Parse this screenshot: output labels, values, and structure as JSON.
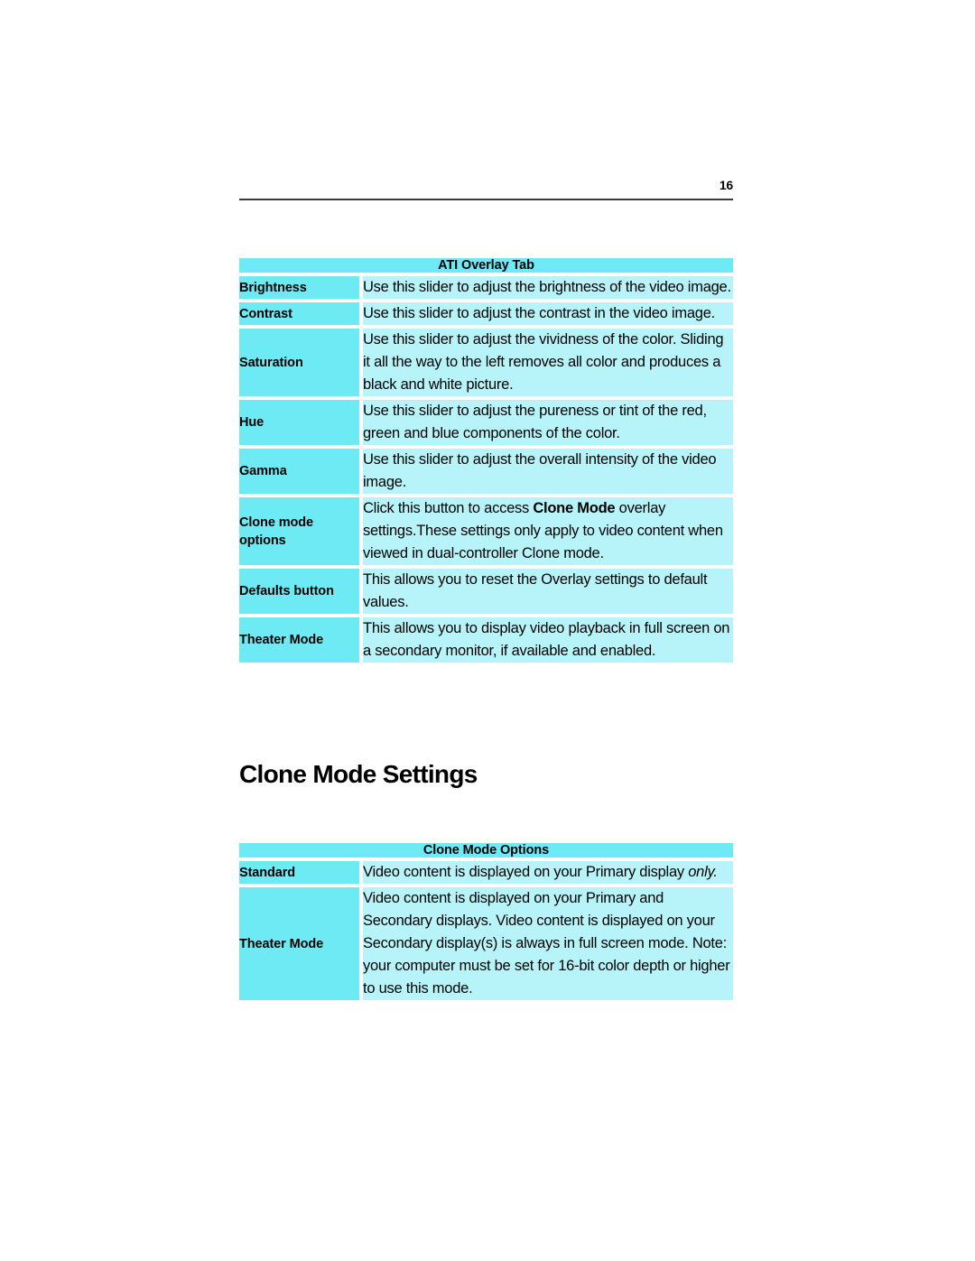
{
  "page": {
    "number": "16"
  },
  "overlay_table": {
    "header": "ATI Overlay Tab",
    "rows": [
      {
        "label": "Brightness",
        "description": "Use this slider to adjust the brightness of the video image."
      },
      {
        "label": "Contrast",
        "description": "Use this slider to adjust the contrast in the video image."
      },
      {
        "label": "Saturation",
        "description": "Use this slider to adjust the vividness of the color. Sliding it all the way to the left removes all color and produces a black and white picture."
      },
      {
        "label": "Hue",
        "description": "Use this slider to adjust the pureness or tint of the red, green and blue components of the color."
      },
      {
        "label": "Gamma",
        "description": "Use this slider to adjust the overall intensity of the video image."
      },
      {
        "label": "Clone mode options",
        "description_pre": "Click this button to access ",
        "description_bold": "Clone Mode",
        "description_post": " overlay settings.These settings only apply to video content when viewed in dual-controller Clone mode."
      },
      {
        "label": "Defaults button",
        "description": "This allows you to reset the Overlay settings to default values."
      },
      {
        "label": "Theater Mode",
        "description": "This allows you to display video playback in full screen on a secondary monitor, if available and enabled."
      }
    ]
  },
  "section": {
    "heading": "Clone Mode Settings"
  },
  "clone_table": {
    "header": "Clone Mode Options",
    "rows": [
      {
        "label": "Standard",
        "description_pre": "Video content is displayed on your Primary display ",
        "description_italic": "only."
      },
      {
        "label": "Theater Mode",
        "description": "Video content is displayed on your Primary and Secondary displays. Video content is displayed on your Secondary display(s) is always in full screen mode. Note: your computer must be set for 16-bit color depth or higher to use this mode."
      }
    ]
  },
  "colors": {
    "header_cyan": "#6eeaf5",
    "label_cyan": "#6eeaf5",
    "description_cyan": "#b6f4fa",
    "rule": "#3b3b3b",
    "text": "#000000"
  }
}
